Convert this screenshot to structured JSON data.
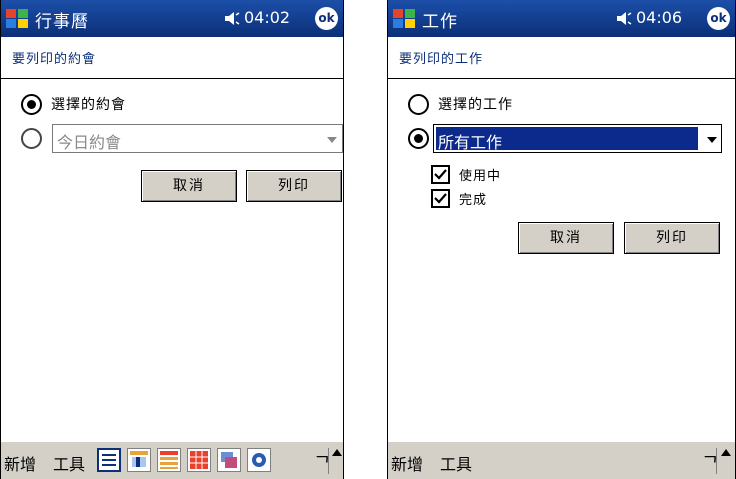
{
  "screens": [
    {
      "title": "行事曆",
      "time": "04:02",
      "ok_label": "ok",
      "header": "要列印的約會",
      "radio_options": [
        {
          "label": "選擇的約會",
          "selected": true
        },
        {
          "label": "",
          "selected": false
        }
      ],
      "dropdown_value": "今日約會",
      "cancel_label": "取消",
      "print_label": "列印",
      "menu": {
        "new": "新增",
        "tools": "工具"
      },
      "view_icons": [
        "agenda-view-icon",
        "day-view-icon",
        "week-view-icon",
        "month-view-icon",
        "year-view-icon",
        "today-icon"
      ]
    },
    {
      "title": "工作",
      "time": "04:06",
      "ok_label": "ok",
      "header": "要列印的工作",
      "radio_options": [
        {
          "label": "選擇的工作",
          "selected": false
        },
        {
          "label": "",
          "selected": true
        }
      ],
      "dropdown_value": "所有工作",
      "checkboxes": [
        {
          "label": "使用中",
          "checked": true
        },
        {
          "label": "完成",
          "checked": true
        }
      ],
      "cancel_label": "取消",
      "print_label": "列印",
      "menu": {
        "new": "新增",
        "tools": "工具"
      }
    }
  ],
  "colors": {
    "titlebar": "#0b2f78",
    "selection": "#0b2a8c",
    "button": "#d4d0c8"
  }
}
